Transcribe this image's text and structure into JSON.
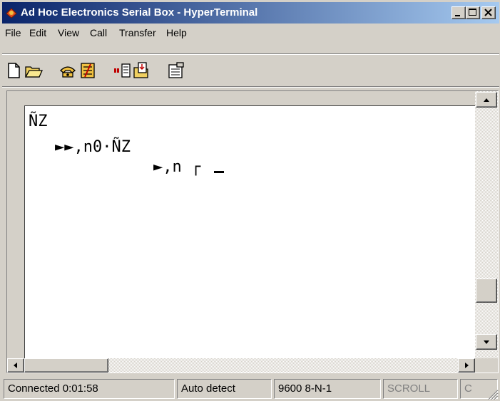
{
  "window": {
    "title": "Ad Hoc Electronics Serial Box - HyperTerminal"
  },
  "menu": [
    "File",
    "Edit",
    "View",
    "Call",
    "Transfer",
    "Help"
  ],
  "toolbar": [
    "new-document-icon",
    "open-folder-icon",
    "dial-phone-icon",
    "disconnect-icon",
    "send-file-icon",
    "receive-file-icon",
    "properties-icon"
  ],
  "terminal": {
    "lines": [
      "ÑZ",
      "►►,n0·ÑZ",
      "►,n ┌"
    ]
  },
  "status": {
    "connected": "Connected 0:01:58",
    "detect": "Auto detect",
    "settings": "9600 8-N-1",
    "scroll": "SCROLL",
    "caps": "C"
  },
  "colors": {
    "title_start": "#0a246a",
    "title_end": "#a6caf0",
    "face": "#d4d0c8"
  }
}
